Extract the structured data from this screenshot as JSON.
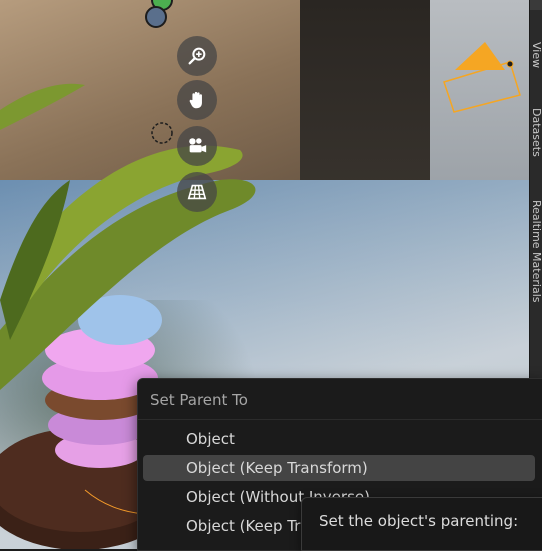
{
  "sidebar": {
    "tabs": [
      {
        "label": "View"
      },
      {
        "label": "Datasets"
      },
      {
        "label": "Realtime Materials"
      }
    ]
  },
  "navigation": {
    "zoom_icon": "zoom-magnifier-icon",
    "pan_icon": "hand-pan-icon",
    "camera_icon": "camera-view-icon",
    "ortho_icon": "grid-perspective-icon"
  },
  "context_menu": {
    "title": "Set Parent To",
    "items": [
      {
        "label": "Object",
        "active": false
      },
      {
        "label": "Object (Keep Transform)",
        "active": true
      },
      {
        "label": "Object (Without Inverse)",
        "active": false
      },
      {
        "label": "Object (Keep Transform Without Inverse)",
        "active": false
      }
    ]
  },
  "tooltip": {
    "text": "Set the object's parenting:"
  },
  "colors": {
    "menu_bg": "#1b1b1b",
    "menu_active": "#444444",
    "light_gizmo": "#f5a623"
  }
}
